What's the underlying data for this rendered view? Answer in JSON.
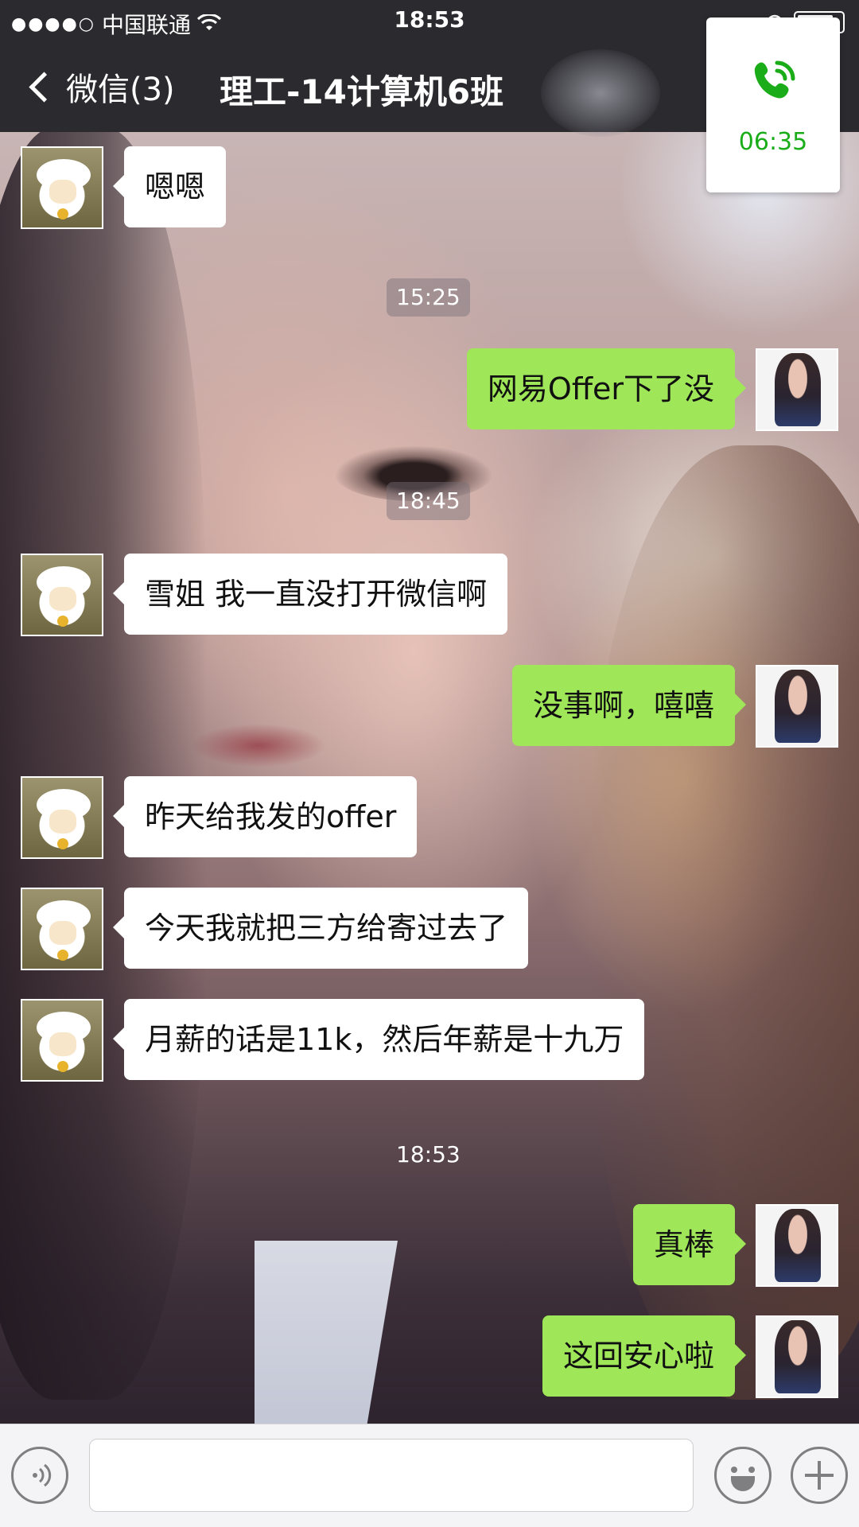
{
  "status_bar": {
    "signal": "●●●●○",
    "carrier": "中国联通",
    "time": "18:53"
  },
  "nav": {
    "back_label": "微信(3)",
    "title": "理工-14计算机6班"
  },
  "call": {
    "duration": "06:35",
    "accent_color": "#1aad19"
  },
  "messages": [
    {
      "type": "in",
      "text": "嗯嗯"
    },
    {
      "type": "time",
      "text": "15:25"
    },
    {
      "type": "out",
      "text": "网易Offer下了没"
    },
    {
      "type": "time",
      "text": "18:45"
    },
    {
      "type": "in",
      "text": "雪姐 我一直没打开微信啊"
    },
    {
      "type": "out",
      "text": "没事啊，嘻嘻"
    },
    {
      "type": "in",
      "text": "昨天给我发的offer"
    },
    {
      "type": "in",
      "text": "今天我就把三方给寄过去了"
    },
    {
      "type": "in",
      "text": "月薪的话是11k，然后年薪是十九万"
    },
    {
      "type": "time",
      "text": "18:53"
    },
    {
      "type": "out",
      "text": "真棒"
    },
    {
      "type": "out",
      "text": "这回安心啦"
    }
  ],
  "input_bar": {
    "voice_icon": "voice-icon",
    "emoji_icon": "emoji-icon",
    "plus_icon": "plus-icon",
    "input_value": ""
  },
  "colors": {
    "bar": "#2b2b2f",
    "out_bubble": "#9fe658",
    "in_bubble": "#ffffff"
  }
}
